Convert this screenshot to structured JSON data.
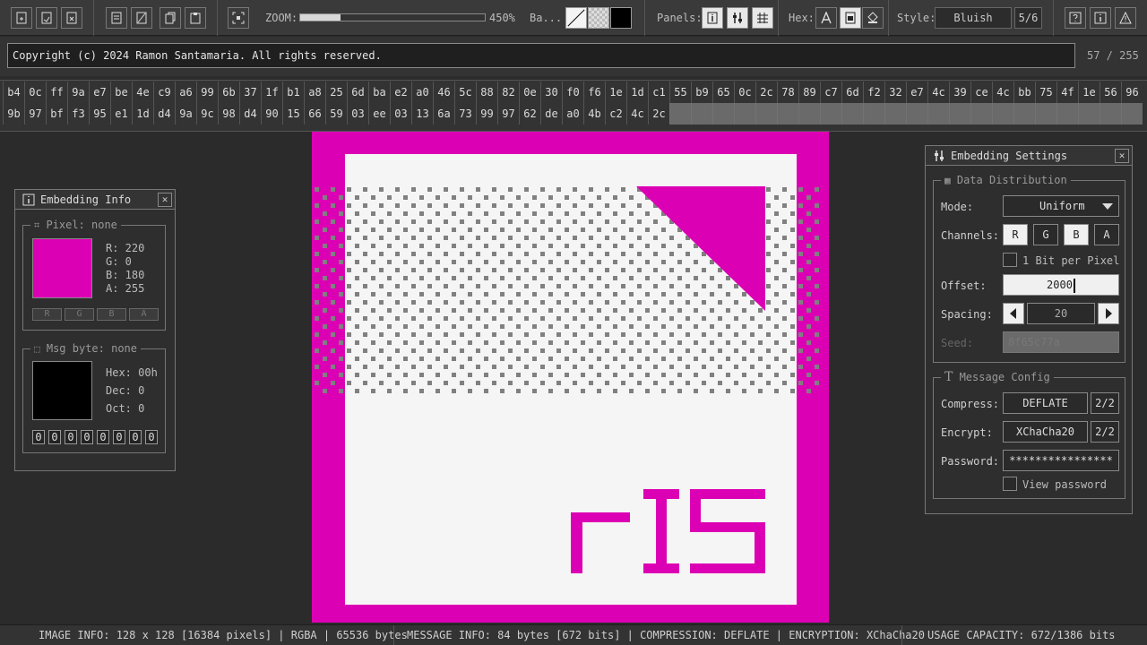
{
  "toolbar": {
    "zoom_label": "ZOOM:",
    "zoom_value": "450%",
    "zoom_level": 0.22,
    "background_label": "Ba...",
    "panels_label": "Panels:",
    "hex_label": "Hex:",
    "style_label": "Style:",
    "style_value": "Bluish",
    "style_count": "5/6"
  },
  "message": {
    "copyright": "Copyright (c) 2024 Ramon Santamaria. All rights reserved.",
    "byte_index": "57 / 255"
  },
  "hex_bytes": [
    "b4",
    "0c",
    "ff",
    "9a",
    "e7",
    "be",
    "4e",
    "c9",
    "a6",
    "99",
    "6b",
    "37",
    "1f",
    "b1",
    "a8",
    "25",
    "6d",
    "ba",
    "e2",
    "a0",
    "46",
    "5c",
    "88",
    "82",
    "0e",
    "30",
    "f0",
    "f6",
    "1e",
    "1d",
    "c1",
    "55",
    "b9",
    "65",
    "0c",
    "2c",
    "78",
    "89",
    "c7",
    "6d",
    "f2",
    "32",
    "e7",
    "4c",
    "39",
    "ce",
    "4c",
    "bb",
    "75",
    "4f",
    "1e",
    "56",
    "96",
    "9b",
    "97",
    "bf",
    "f3",
    "95",
    "e1",
    "1d",
    "d4",
    "9a",
    "9c",
    "98",
    "d4",
    "90",
    "15",
    "66",
    "59",
    "03",
    "ee",
    "03",
    "13",
    "6a",
    "73",
    "99",
    "97",
    "62",
    "de",
    "a0",
    "4b",
    "c2",
    "4c",
    "2c"
  ],
  "embedding_info": {
    "title": "Embedding Info",
    "pixel_label": "Pixel: none",
    "r": "R: 220",
    "g": "G: 0",
    "b": "B: 180",
    "a": "A: 255",
    "pixel_color": "#dc00b4",
    "channel_buttons": [
      "R",
      "G",
      "B",
      "A"
    ],
    "msg_label": "Msg byte: none",
    "hex": "Hex: 00h",
    "dec": "Dec: 0",
    "oct": "Oct: 0",
    "bits": [
      "0",
      "0",
      "0",
      "0",
      "0",
      "0",
      "0",
      "0"
    ]
  },
  "settings": {
    "title": "Embedding Settings",
    "dist_label": "Data Distribution",
    "mode_label": "Mode:",
    "mode_value": "Uniform",
    "channels_label": "Channels:",
    "channels": [
      "R",
      "G",
      "B",
      "A"
    ],
    "bit_per_pixel": "1 Bit per Pixel",
    "offset_label": "Offset:",
    "offset_value": "2000",
    "spacing_label": "Spacing:",
    "spacing_value": "20",
    "seed_label": "Seed:",
    "seed_value": "8f65c77a",
    "msg_config_label": "Message Config",
    "compress_label": "Compress:",
    "compress_value": "DEFLATE",
    "compress_count": "2/2",
    "encrypt_label": "Encrypt:",
    "encrypt_value": "XChaCha20",
    "encrypt_count": "2/2",
    "password_label": "Password:",
    "password_value": "****************",
    "view_password": "View password"
  },
  "status": {
    "image_info": "IMAGE INFO:  128 x 128 [16384 pixels] | RGBA | 65536 bytes",
    "message_info": "MESSAGE INFO: 84 bytes [672 bits] | COMPRESSION: DEFLATE | ENCRYPTION: XChaCha20",
    "usage": "USAGE CAPACITY:  672/1386 bits"
  },
  "image": {
    "logo_text": "rIS",
    "accent": "#dc00b4",
    "bg": "#f5f5f5",
    "dot": "#808080"
  }
}
